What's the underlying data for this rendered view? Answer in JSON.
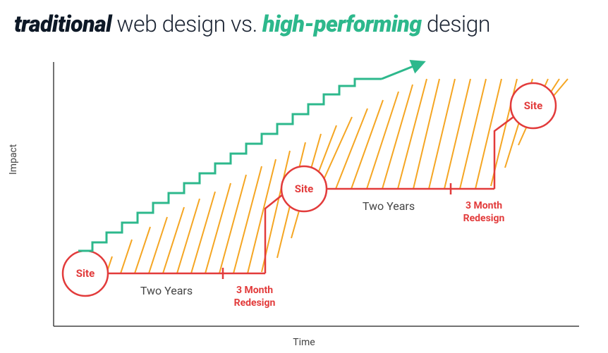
{
  "title": {
    "part1": "traditional",
    "part2": " web design vs. ",
    "part3": "high-performing",
    "part4": " design"
  },
  "axes": {
    "x": "Time",
    "y": "Impact"
  },
  "traditional": {
    "nodes": [
      "Site",
      "Site",
      "Site"
    ],
    "period_label": "Two Years",
    "redesign_label_line1": "3 Month",
    "redesign_label_line2": "Redesign"
  },
  "colors": {
    "traditional": "#e23b3b",
    "high_performing": "#2db88c",
    "hatch": "#f5a623",
    "axis": "#444"
  },
  "chart_data": {
    "type": "line",
    "title": "traditional web design vs. high-performing design",
    "xlabel": "Time",
    "ylabel": "Impact",
    "series": [
      {
        "name": "traditional",
        "description": "Step function: flat for ~24 months, then jump during 3-month redesign, repeated",
        "x_months": [
          0,
          24,
          27,
          51,
          54
        ],
        "impact": [
          10,
          10,
          40,
          40,
          75
        ]
      },
      {
        "name": "high-performing",
        "description": "Continuous small step increments, roughly linear growth",
        "x_months": [
          0,
          5,
          10,
          15,
          20,
          25,
          30,
          35,
          40,
          45,
          50
        ],
        "impact": [
          12,
          22,
          32,
          42,
          52,
          62,
          72,
          82,
          92,
          100,
          108
        ]
      }
    ],
    "annotations": [
      {
        "text": "Site",
        "series": "traditional",
        "x_months": 0
      },
      {
        "text": "Two Years",
        "series": "traditional",
        "x_months": 12
      },
      {
        "text": "3 Month Redesign",
        "series": "traditional",
        "x_months": 25.5
      },
      {
        "text": "Site",
        "series": "traditional",
        "x_months": 27
      },
      {
        "text": "Two Years",
        "series": "traditional",
        "x_months": 39
      },
      {
        "text": "3 Month Redesign",
        "series": "traditional",
        "x_months": 52.5
      },
      {
        "text": "Site",
        "series": "traditional",
        "x_months": 54
      }
    ],
    "area_between_series": "hatched orange (gap = opportunity cost)"
  }
}
